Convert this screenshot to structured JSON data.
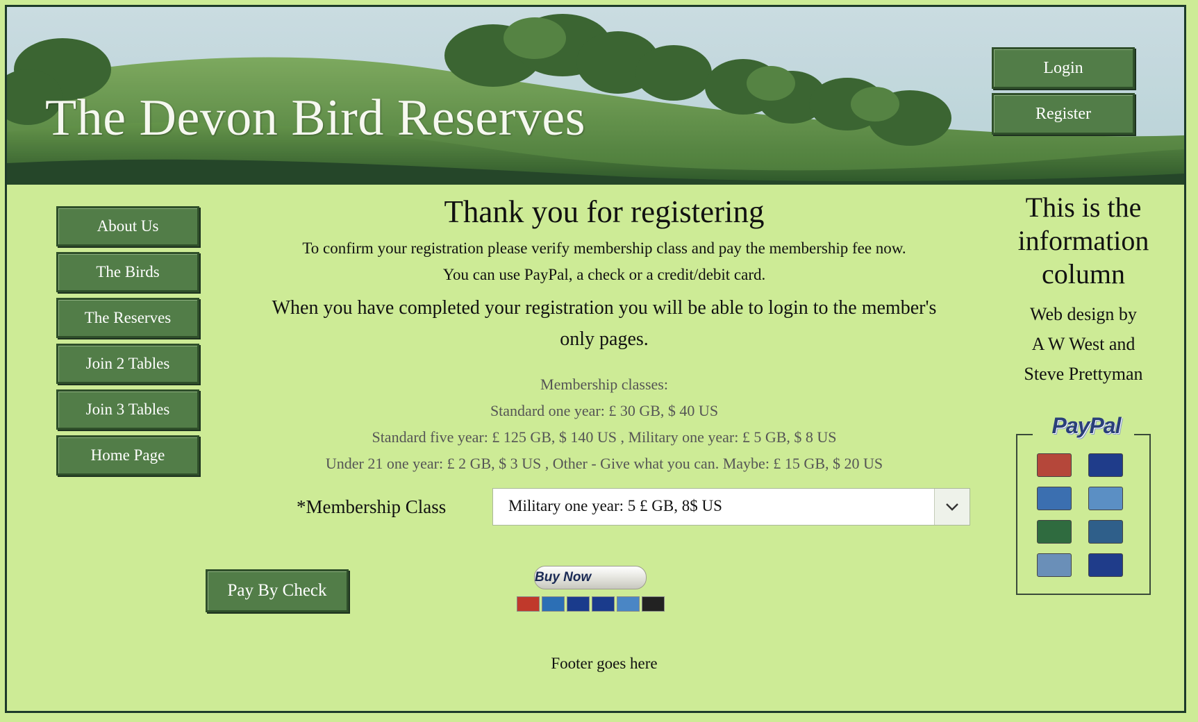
{
  "header": {
    "site_title": "The Devon Bird Reserves",
    "login_label": "Login",
    "register_label": "Register"
  },
  "nav": {
    "items": [
      {
        "label": "About Us"
      },
      {
        "label": "The Birds"
      },
      {
        "label": "The Reserves"
      },
      {
        "label": "Join 2 Tables"
      },
      {
        "label": "Join 3 Tables"
      },
      {
        "label": "Home Page"
      }
    ]
  },
  "main": {
    "heading": "Thank you for registering",
    "confirm_text": "To confirm your registration please verify membership class and pay the membership fee now.",
    "payment_text": "You can use PayPal, a check or a credit/debit card.",
    "login_text": "When you have completed your registration you will be able to login to the member's only pages.",
    "classes_heading": "Membership classes:",
    "classes": [
      "Standard one year: £ 30 GB, $ 40 US",
      "Standard five year: £ 125 GB, $ 140 US , Military one year: £ 5 GB, $ 8 US",
      "Under 21 one year: £ 2 GB, $ 3 US , Other - Give what you can. Maybe: £ 15 GB, $ 20 US"
    ],
    "membership_label": "*Membership Class",
    "membership_selected": "Military one year: 5 £ GB, 8$ US",
    "pay_check_label": "Pay By Check",
    "buy_now_label": "Buy Now",
    "footer": "Footer goes here"
  },
  "buy_now_cards": [
    "MC",
    "Maestro",
    "VISA",
    "VISA",
    "AMEX",
    "DD"
  ],
  "info": {
    "title": "This is the information column",
    "credits_line1": "Web design by",
    "credits_line2": "A W West and",
    "credits_line3": "Steve Prettyman",
    "paypal_logo": "PayPal",
    "cards": [
      "MC",
      "VISA",
      "Maestro",
      "AMEX",
      "Switch",
      "Solo",
      "Delta",
      "VISA Electron"
    ]
  },
  "colors": {
    "page_bg": "#cdeb96",
    "button_bg": "#527d48",
    "button_border": "#2f4f2a",
    "paypal_blue": "#2a3f7a"
  },
  "icons": {
    "select_arrow": "chevron-down-icon"
  }
}
